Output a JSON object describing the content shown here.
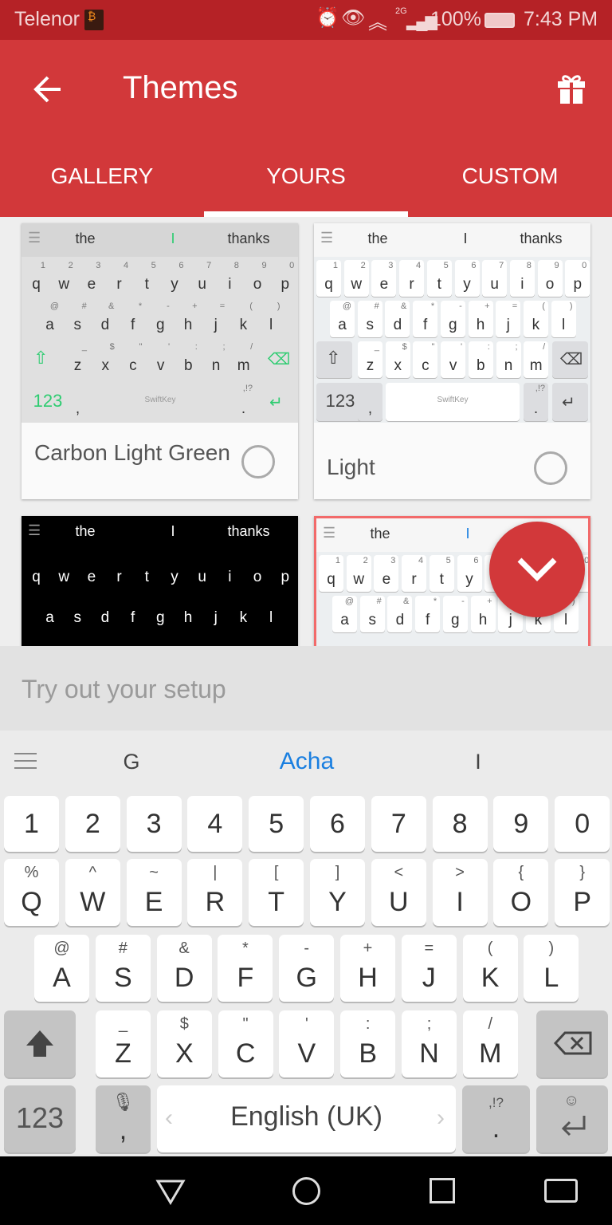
{
  "status": {
    "carrier": "Telenor",
    "network": "2G",
    "battery": "100%",
    "time": "7:43 PM",
    "icons": [
      "bitcoin-app-icon",
      "alarm-icon",
      "eye-icon",
      "wifi-icon",
      "signal-icon",
      "battery-icon"
    ]
  },
  "appbar": {
    "title": "Themes",
    "back_icon": "arrow-left-icon",
    "gift_icon": "gift-icon"
  },
  "tabs": [
    {
      "label": "GALLERY"
    },
    {
      "label": "YOURS",
      "selected": true
    },
    {
      "label": "CUSTOM"
    }
  ],
  "themes": [
    {
      "name": "Carbon Light Green",
      "suggestions": [
        "the",
        "I",
        "thanks"
      ],
      "selected": false
    },
    {
      "name": "Light",
      "suggestions": [
        "the",
        "I",
        "thanks"
      ],
      "selected": false
    },
    {
      "name": "",
      "suggestions": [
        "the",
        "I",
        "thanks"
      ]
    },
    {
      "name": "",
      "suggestions": [
        "the",
        "I",
        ""
      ],
      "selected": true
    }
  ],
  "thumb": {
    "row1": [
      "q",
      "w",
      "e",
      "r",
      "t",
      "y",
      "u",
      "i",
      "o",
      "p"
    ],
    "row1s": [
      "1",
      "2",
      "3",
      "4",
      "5",
      "6",
      "7",
      "8",
      "9",
      "0"
    ],
    "row2": [
      "a",
      "s",
      "d",
      "f",
      "g",
      "h",
      "j",
      "k",
      "l"
    ],
    "row2s": [
      "@",
      "#",
      "&",
      "*",
      "-",
      "+",
      "=",
      "(",
      ")"
    ],
    "row3": [
      "z",
      "x",
      "c",
      "v",
      "b",
      "n",
      "m"
    ],
    "row3s": [
      "_",
      "$",
      "\"",
      "'",
      ":",
      ";",
      "/"
    ],
    "num": "123",
    "comma": ",",
    "punct": ",!?",
    "dot": ".",
    "brand": "SwiftKey"
  },
  "tryout": {
    "placeholder": "Try out your setup"
  },
  "keyboard": {
    "suggestions": [
      "G",
      "Acha",
      "I"
    ],
    "numbers": [
      "1",
      "2",
      "3",
      "4",
      "5",
      "6",
      "7",
      "8",
      "9",
      "0"
    ],
    "row1": [
      [
        "Q",
        "%"
      ],
      [
        "W",
        "^"
      ],
      [
        "E",
        "~"
      ],
      [
        "R",
        "|"
      ],
      [
        "T",
        "["
      ],
      [
        "Y",
        "]"
      ],
      [
        "U",
        "<"
      ],
      [
        "I",
        ">"
      ],
      [
        "O",
        "{"
      ],
      [
        "P",
        "}"
      ]
    ],
    "row2": [
      [
        "A",
        "@"
      ],
      [
        "S",
        "#"
      ],
      [
        "D",
        "&"
      ],
      [
        "F",
        "*"
      ],
      [
        "G",
        "-"
      ],
      [
        "H",
        "+"
      ],
      [
        "J",
        "="
      ],
      [
        "K",
        "("
      ],
      [
        "L",
        ")"
      ]
    ],
    "row3": [
      [
        "Z",
        "_"
      ],
      [
        "X",
        "$"
      ],
      [
        "C",
        "\""
      ],
      [
        "V",
        "'"
      ],
      [
        "B",
        ":"
      ],
      [
        "N",
        ";"
      ],
      [
        "M",
        "/"
      ]
    ],
    "num_label": "123",
    "comma": ",",
    "space": "English (UK)",
    "punct": ",!?",
    "dot": ".",
    "accent": "#1a7fe0"
  },
  "colors": {
    "primary": "#d2383a",
    "status": "#b52226",
    "green": "#2ecc71"
  }
}
